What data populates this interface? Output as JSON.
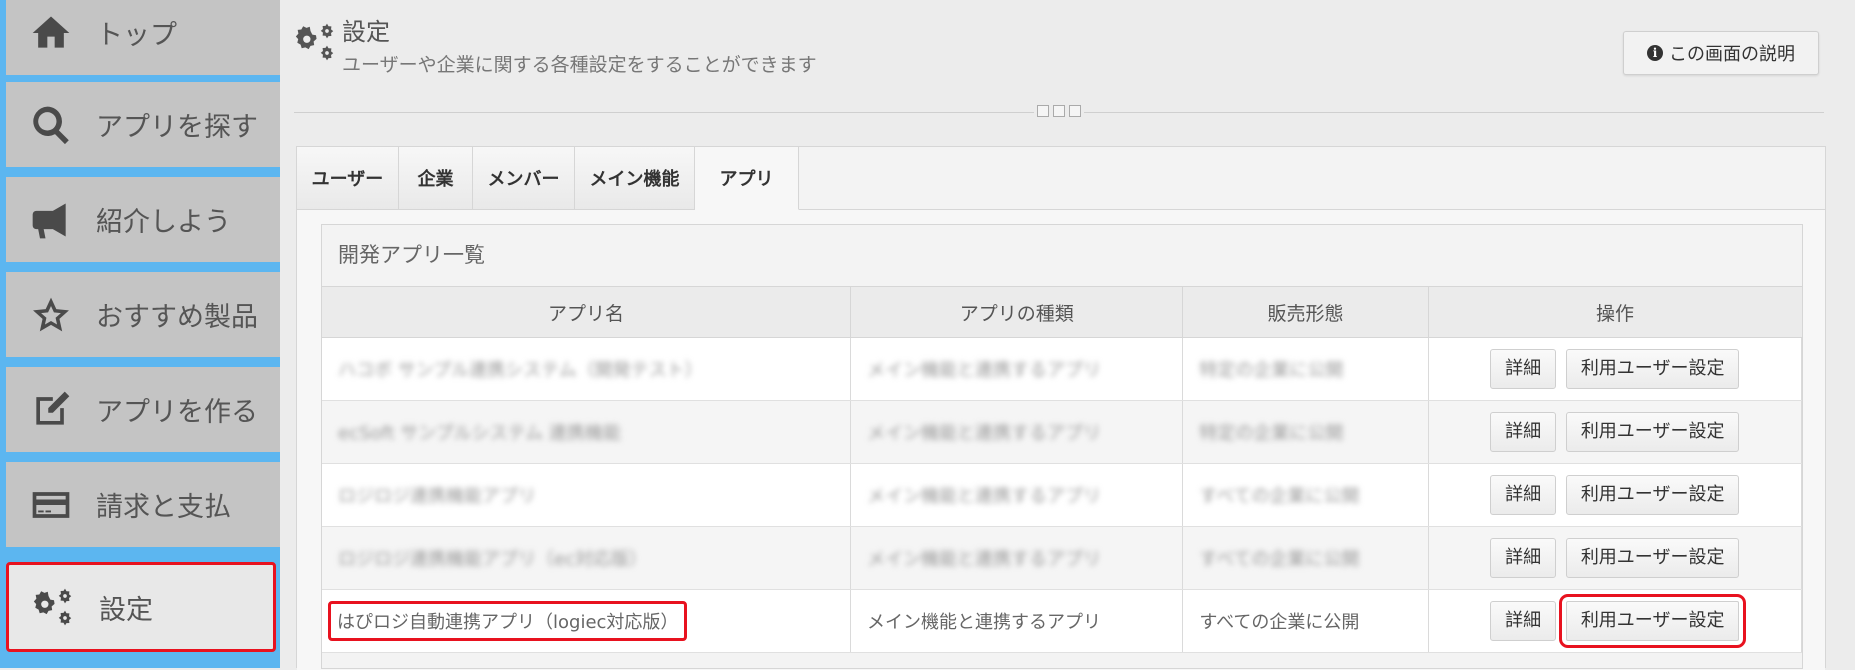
{
  "sidebar": {
    "items": [
      {
        "label": "トップ",
        "icon": "home-icon"
      },
      {
        "label": "アプリを探す",
        "icon": "search-icon"
      },
      {
        "label": "紹介しよう",
        "icon": "megaphone-icon"
      },
      {
        "label": "おすすめ製品",
        "icon": "star-icon"
      },
      {
        "label": "アプリを作る",
        "icon": "edit-icon"
      },
      {
        "label": "請求と支払",
        "icon": "credit-card-icon"
      },
      {
        "label": "設定",
        "icon": "gears-icon"
      }
    ]
  },
  "header": {
    "title": "設定",
    "subtitle": "ユーザーや企業に関する各種設定をすることができます",
    "help_label": "この画面の説明"
  },
  "tabs": [
    {
      "label": "ユーザー"
    },
    {
      "label": "企業"
    },
    {
      "label": "メンバー"
    },
    {
      "label": "メイン機能"
    },
    {
      "label": "アプリ"
    }
  ],
  "app_list": {
    "title": "開発アプリ一覧",
    "columns": [
      "アプリ名",
      "アプリの種類",
      "販売形態",
      "操作"
    ],
    "rows": [
      {
        "name": "ハコボ サンプル連携システム（開発テスト）",
        "type": "メイン機能と連携するアプリ",
        "sales": "特定の企業に公開"
      },
      {
        "name": "ecSoft サンプルシステム 連携機能",
        "type": "メイン機能と連携するアプリ",
        "sales": "特定の企業に公開"
      },
      {
        "name": "ロジロジ連携機能アプリ",
        "type": "メイン機能と連携するアプリ",
        "sales": "すべての企業に公開"
      },
      {
        "name": "ロジロジ連携機能アプリ（ec対応版）",
        "type": "メイン機能と連携するアプリ",
        "sales": "すべての企業に公開"
      },
      {
        "name": "はぴロジ自動連携アプリ（logiec対応版）",
        "type": "メイン機能と連携するアプリ",
        "sales": "すべての企業に公開"
      }
    ],
    "detail_label": "詳細",
    "user_settings_label": "利用ユーザー設定"
  }
}
